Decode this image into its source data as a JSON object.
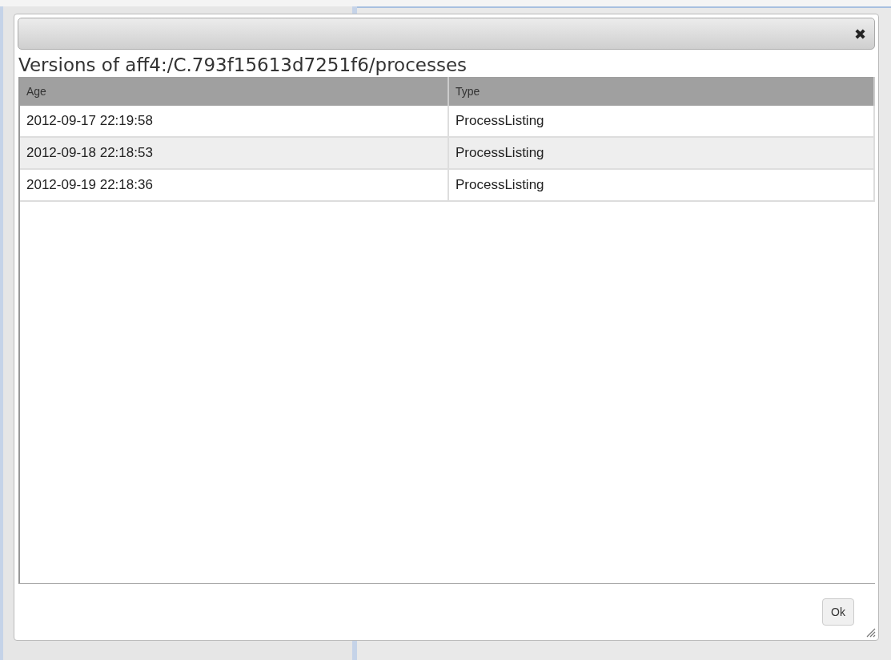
{
  "dialog": {
    "title": "Versions of aff4:/C.793f15613d7251f6/processes",
    "close_label": "✖",
    "table": {
      "columns": [
        "Age",
        "Type"
      ],
      "rows": [
        {
          "cells": [
            "2012-09-17 22:19:58",
            "ProcessListing"
          ]
        },
        {
          "cells": [
            "2012-09-18 22:18:53",
            "ProcessListing"
          ]
        },
        {
          "cells": [
            "2012-09-19 22:18:36",
            "ProcessListing"
          ]
        }
      ]
    },
    "buttons": [
      "Ok"
    ]
  }
}
